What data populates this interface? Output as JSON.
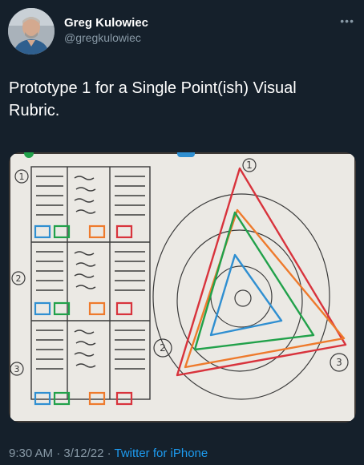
{
  "tweet": {
    "author": {
      "display_name": "Greg Kulowiec",
      "handle": "@gregkulowiec"
    },
    "more_icon": "more-horizontal-icon",
    "text": "Prototype 1 for a Single Point(ish) Visual Rubric.",
    "media": {
      "colors": {
        "red": "#d8333c",
        "orange": "#ee7a2c",
        "green": "#21a14a",
        "blue": "#2f8fd1"
      },
      "handwritten_labels": [
        "1",
        "2",
        "3",
        "1",
        "2",
        "3"
      ]
    },
    "time": "9:30 AM",
    "date": "3/12/22",
    "separator": " · ",
    "source": "Twitter for iPhone"
  }
}
